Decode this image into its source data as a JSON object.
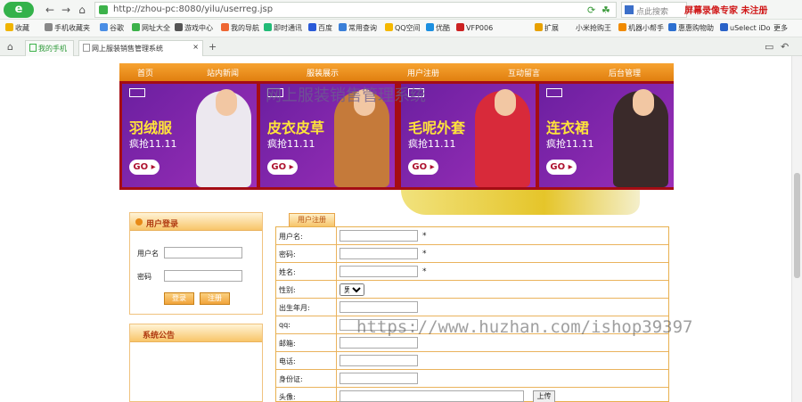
{
  "browser": {
    "url": "http://zhou-pc:8080/yilu/userreg.jsp",
    "search_placeholder": "点此搜索",
    "brand_text": "屏幕录像专家 未注册",
    "logo_letter": "e",
    "bookmarks": [
      "收藏",
      "手机收藏夹",
      "谷歌",
      "网址大全",
      "游戏中心",
      "我的导航",
      "即时通讯",
      "百度",
      "常用查询",
      "QQ空间",
      "优酷",
      "VFP006",
      "扩展",
      "小米抢购王",
      "机器小帮手",
      "惠惠购物助",
      "uSelect iDo",
      "更多"
    ],
    "tabs": [
      "我的手机",
      "网上服装销售管理系统"
    ]
  },
  "site": {
    "title": "网上服装销售管理系统",
    "menu": [
      "首页",
      "站内新闻",
      "服装展示",
      "用户注册",
      "互动留言",
      "后台管理"
    ],
    "banners": [
      {
        "title": "羽绒服",
        "sub": "疯抢11.11",
        "go": "GO"
      },
      {
        "title": "皮衣皮草",
        "sub": "疯抢11.11",
        "go": "GO"
      },
      {
        "title": "毛呢外套",
        "sub": "疯抢11.11",
        "go": "GO"
      },
      {
        "title": "连衣裙",
        "sub": "疯抢11.11",
        "go": "GO"
      }
    ]
  },
  "login": {
    "title": "用户登录",
    "username_label": "用户名",
    "password_label": "密码",
    "login_button": "登录",
    "register_button": "注册"
  },
  "notice": {
    "title": "系统公告"
  },
  "register": {
    "tab_label": "用户注册",
    "fields": [
      {
        "label": "用户名:",
        "required": true
      },
      {
        "label": "密码:",
        "required": true
      },
      {
        "label": "姓名:",
        "required": true
      },
      {
        "label": "性别:",
        "type": "select",
        "value": "男"
      },
      {
        "label": "出生年月:"
      },
      {
        "label": "qq:"
      },
      {
        "label": "邮箱:"
      },
      {
        "label": "电话:"
      },
      {
        "label": "身份证:"
      },
      {
        "label": "头像:",
        "type": "upload",
        "button": "上传"
      }
    ],
    "required_mark": "*"
  },
  "watermark": "https://www.huzhan.com/ishop39397",
  "colors": {
    "menu_orange": "#e8891c",
    "banner_red": "#a40c14",
    "brand_red": "#d01818",
    "title_purple": "#6c5f8f"
  }
}
